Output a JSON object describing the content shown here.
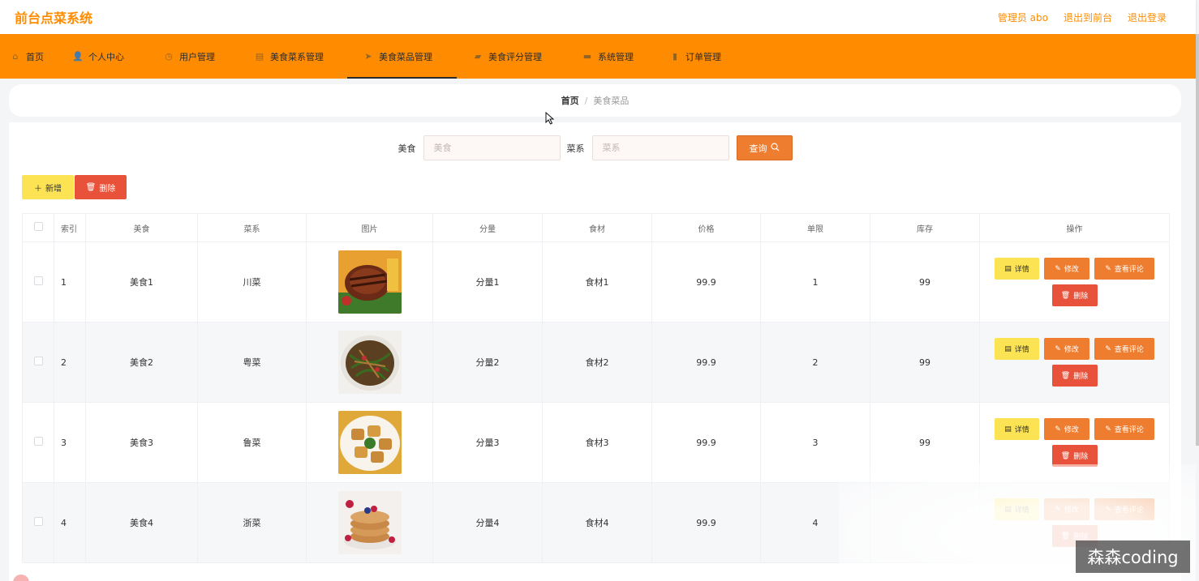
{
  "header": {
    "app_title": "前台点菜系统",
    "links": [
      "管理员 abo",
      "退出到前台",
      "退出登录"
    ]
  },
  "nav": {
    "items": [
      {
        "label": "首页",
        "icon": "home-icon",
        "glyph": "⌂"
      },
      {
        "label": "个人中心",
        "icon": "user-icon",
        "glyph": "👤"
      },
      {
        "label": "用户管理",
        "icon": "clock-icon",
        "glyph": "◷"
      },
      {
        "label": "美食菜系管理",
        "icon": "calendar-icon",
        "glyph": "▤"
      },
      {
        "label": "美食菜品管理",
        "icon": "send-icon",
        "glyph": "➤"
      },
      {
        "label": "美食评分管理",
        "icon": "folder-icon",
        "glyph": "▰"
      },
      {
        "label": "系统管理",
        "icon": "laptop-icon",
        "glyph": "▬"
      },
      {
        "label": "订单管理",
        "icon": "chart-icon",
        "glyph": "▮"
      }
    ],
    "active_index": 4
  },
  "breadcrumb": {
    "home": "首页",
    "separator": "/",
    "current": "美食菜品"
  },
  "search": {
    "food_label": "美食",
    "food_placeholder": "美食",
    "cuisine_label": "菜系",
    "cuisine_placeholder": "菜系",
    "query_label": "查询"
  },
  "actions": {
    "add_label": "新增",
    "delete_label": "删除"
  },
  "table": {
    "columns": [
      "",
      "索引",
      "美食",
      "菜系",
      "图片",
      "分量",
      "食材",
      "价格",
      "单限",
      "库存",
      "操作"
    ],
    "rows": [
      {
        "index": "1",
        "food": "美食1",
        "cuisine": "川菜",
        "portion": "分量1",
        "ingredient": "食材1",
        "price": "99.9",
        "limit": "1",
        "stock": "99",
        "image": "grilled-steak"
      },
      {
        "index": "2",
        "food": "美食2",
        "cuisine": "粤菜",
        "portion": "分量2",
        "ingredient": "食材2",
        "price": "99.9",
        "limit": "2",
        "stock": "99",
        "image": "noodle-salad"
      },
      {
        "index": "3",
        "food": "美食3",
        "cuisine": "鲁菜",
        "portion": "分量3",
        "ingredient": "食材3",
        "price": "99.9",
        "limit": "3",
        "stock": "99",
        "image": "fried-tofu"
      },
      {
        "index": "4",
        "food": "美食4",
        "cuisine": "浙菜",
        "portion": "分量4",
        "ingredient": "食材4",
        "price": "99.9",
        "limit": "4",
        "stock": "",
        "image": "pancakes"
      }
    ],
    "row_actions": {
      "detail": "详情",
      "edit": "修改",
      "review": "查看评论",
      "delete": "删除"
    }
  },
  "watermark": "森森coding",
  "colors": {
    "brand": "#ff8c00",
    "button_orange": "#ee7d30",
    "button_yellow": "#fbe353",
    "button_red": "#e8523a"
  }
}
